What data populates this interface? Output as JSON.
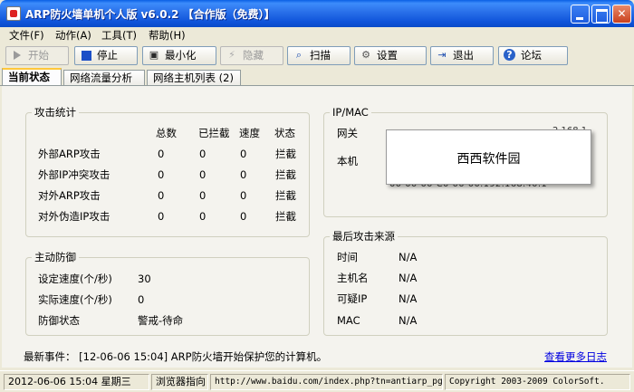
{
  "window": {
    "title": "ARP防火墙单机个人版 v6.0.2 【合作版（免费）】"
  },
  "menu": [
    "文件(F)",
    "动作(A)",
    "工具(T)",
    "帮助(H)"
  ],
  "toolbar": {
    "start": "开始",
    "stop": "停止",
    "minimize": "最小化",
    "hide": "隐藏",
    "scan": "扫描",
    "settings": "设置",
    "exit": "退出",
    "forum": "论坛"
  },
  "tabs": [
    "当前状态",
    "网络流量分析",
    "网络主机列表 (2)"
  ],
  "attack_stats": {
    "title": "攻击统计",
    "headers": [
      "总数",
      "已拦截",
      "速度",
      "状态"
    ],
    "rows": [
      {
        "label": "外部ARP攻击",
        "total": "0",
        "blocked": "0",
        "speed": "0",
        "status": "拦截"
      },
      {
        "label": "外部IP冲突攻击",
        "total": "0",
        "blocked": "0",
        "speed": "0",
        "status": "拦截"
      },
      {
        "label": "对外ARP攻击",
        "total": "0",
        "blocked": "0",
        "speed": "0",
        "status": "拦截"
      },
      {
        "label": "对外伪造IP攻击",
        "total": "0",
        "blocked": "0",
        "speed": "0",
        "status": "拦截"
      }
    ]
  },
  "ipmac": {
    "title": "IP/MAC",
    "gateway_label": "网关",
    "local_label": "本机",
    "gateway_value_partial": "2.168.1",
    "local_value_partial": "00-00-00-C0-00-00.192.168.40.1"
  },
  "active_defense": {
    "title": "主动防御",
    "rows": [
      {
        "label": "设定速度(个/秒)",
        "value": "30"
      },
      {
        "label": "实际速度(个/秒)",
        "value": "0"
      },
      {
        "label": "防御状态",
        "value": "警戒-待命"
      }
    ]
  },
  "last_attack": {
    "title": "最后攻击来源",
    "rows": [
      {
        "label": "时间",
        "value": "N/A"
      },
      {
        "label": "主机名",
        "value": "N/A"
      },
      {
        "label": "可疑IP",
        "value": "N/A"
      },
      {
        "label": "MAC",
        "value": "N/A"
      }
    ]
  },
  "popup": {
    "text": "西西软件园"
  },
  "event": {
    "label": "最新事件：  [12-06-06 15:04] ARP防火墙开始保护您的计算机。",
    "link": "查看更多日志"
  },
  "statusbar": {
    "datetime": "2012-06-06 15:04 星期三",
    "browser_label": "浏览器指向",
    "url": "http://www.baidu.com/index.php?tn=antiarp_pg",
    "copyright": "Copyright 2003-2009 ColorSoft."
  }
}
